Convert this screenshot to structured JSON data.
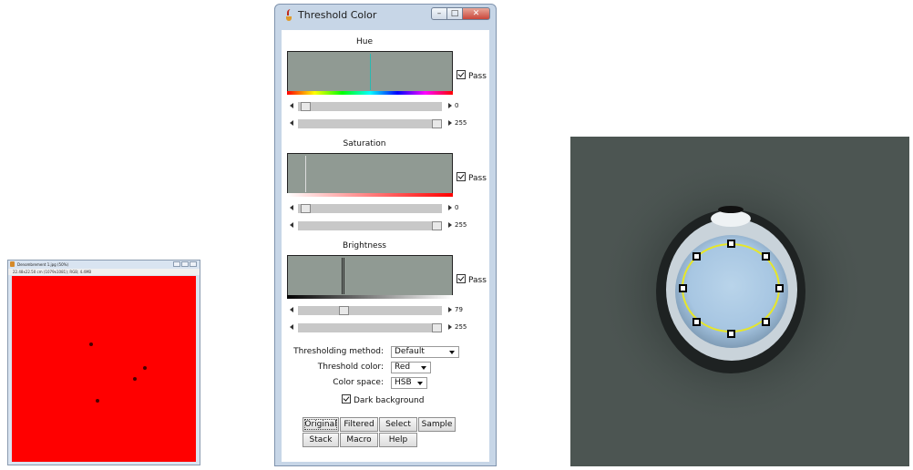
{
  "image_window": {
    "title": "Denombrement 1.jpg (50%)",
    "info": "22.48x22.50 cm (1079x1081); RGB; 4.4MB",
    "canvas_color": "#ff0000"
  },
  "threshold_window": {
    "title": "Threshold Color",
    "controls": {
      "minimize": "–",
      "maximize": "□",
      "close": "✕"
    },
    "sections": [
      {
        "label": "Hue",
        "pass_label": "Pass",
        "pass_checked": true,
        "min_value": "0",
        "max_value": "255",
        "min": 0,
        "max": 255,
        "marker_color": "#29b8b0"
      },
      {
        "label": "Saturation",
        "pass_label": "Pass",
        "pass_checked": true,
        "min_value": "0",
        "max_value": "255",
        "min": 0,
        "max": 255,
        "marker_color": "#dcdcdc"
      },
      {
        "label": "Brightness",
        "pass_label": "Pass",
        "pass_checked": true,
        "min_value": "79",
        "max_value": "255",
        "min": 79,
        "max": 255,
        "marker_color": "#222222"
      }
    ],
    "thresholding_method": {
      "label": "Thresholding method:",
      "value": "Default"
    },
    "threshold_color": {
      "label": "Threshold color:",
      "value": "Red"
    },
    "color_space": {
      "label": "Color space:",
      "value": "HSB"
    },
    "dark_background": {
      "label": "Dark background",
      "checked": true
    },
    "buttons": {
      "original": "Original",
      "filtered": "Filtered",
      "select": "Select",
      "sample": "Sample",
      "stack": "Stack",
      "macro": "Macro",
      "help": "Help"
    }
  },
  "zoom_view": {
    "background_color": "#4c5552",
    "selection_color": "#e6e62a"
  }
}
